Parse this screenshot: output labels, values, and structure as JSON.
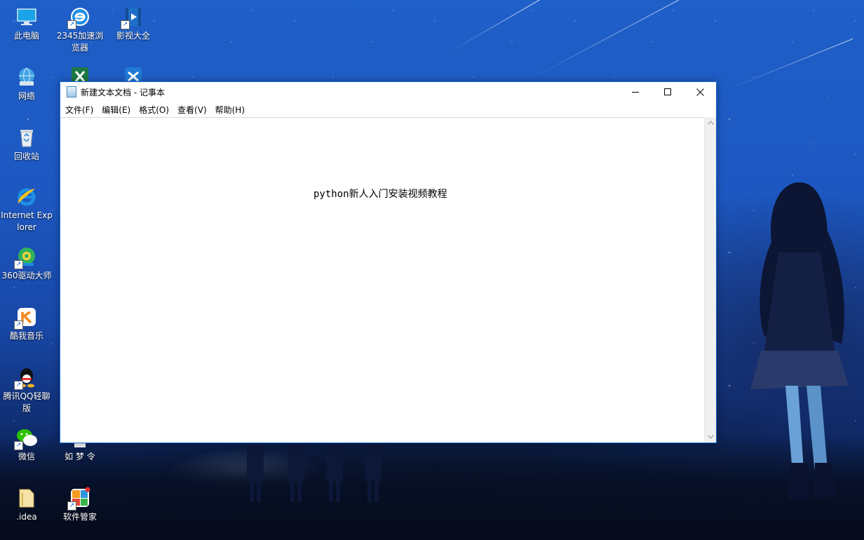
{
  "desktop": {
    "icons": [
      {
        "label": "此电脑",
        "icon": "computer-icon"
      },
      {
        "label": "2345加速浏览器",
        "icon": "browser-icon"
      },
      {
        "label": "影视大全",
        "icon": "video-icon"
      },
      {
        "label": "网络",
        "icon": "network-icon"
      },
      {
        "label": "回收站",
        "icon": "recycle-bin-icon"
      },
      {
        "label": "Internet Explorer",
        "icon": "ie-icon"
      },
      {
        "label": "360驱动大师",
        "icon": "driver-icon"
      },
      {
        "label": "酷我音乐",
        "icon": "music-icon"
      },
      {
        "label": "腾讯QQ轻聊版",
        "icon": "qq-icon"
      },
      {
        "label": "微信",
        "icon": "wechat-icon"
      },
      {
        "label": "如 梦 令",
        "icon": "document-icon"
      },
      {
        "label": ".idea",
        "icon": "folder-icon"
      },
      {
        "label": "软件管家",
        "icon": "software-manager-icon"
      }
    ]
  },
  "notepad": {
    "title": "新建文本文档 - 记事本",
    "menu": [
      "文件(F)",
      "编辑(E)",
      "格式(O)",
      "查看(V)",
      "帮助(H)"
    ],
    "content": "python新人入门安装视频教程",
    "controls": {
      "minimize": "minimize-icon",
      "maximize": "maximize-icon",
      "close": "close-icon"
    }
  },
  "colors": {
    "accent_border": "#1a6fd6",
    "sky": "#1f5fc8"
  }
}
